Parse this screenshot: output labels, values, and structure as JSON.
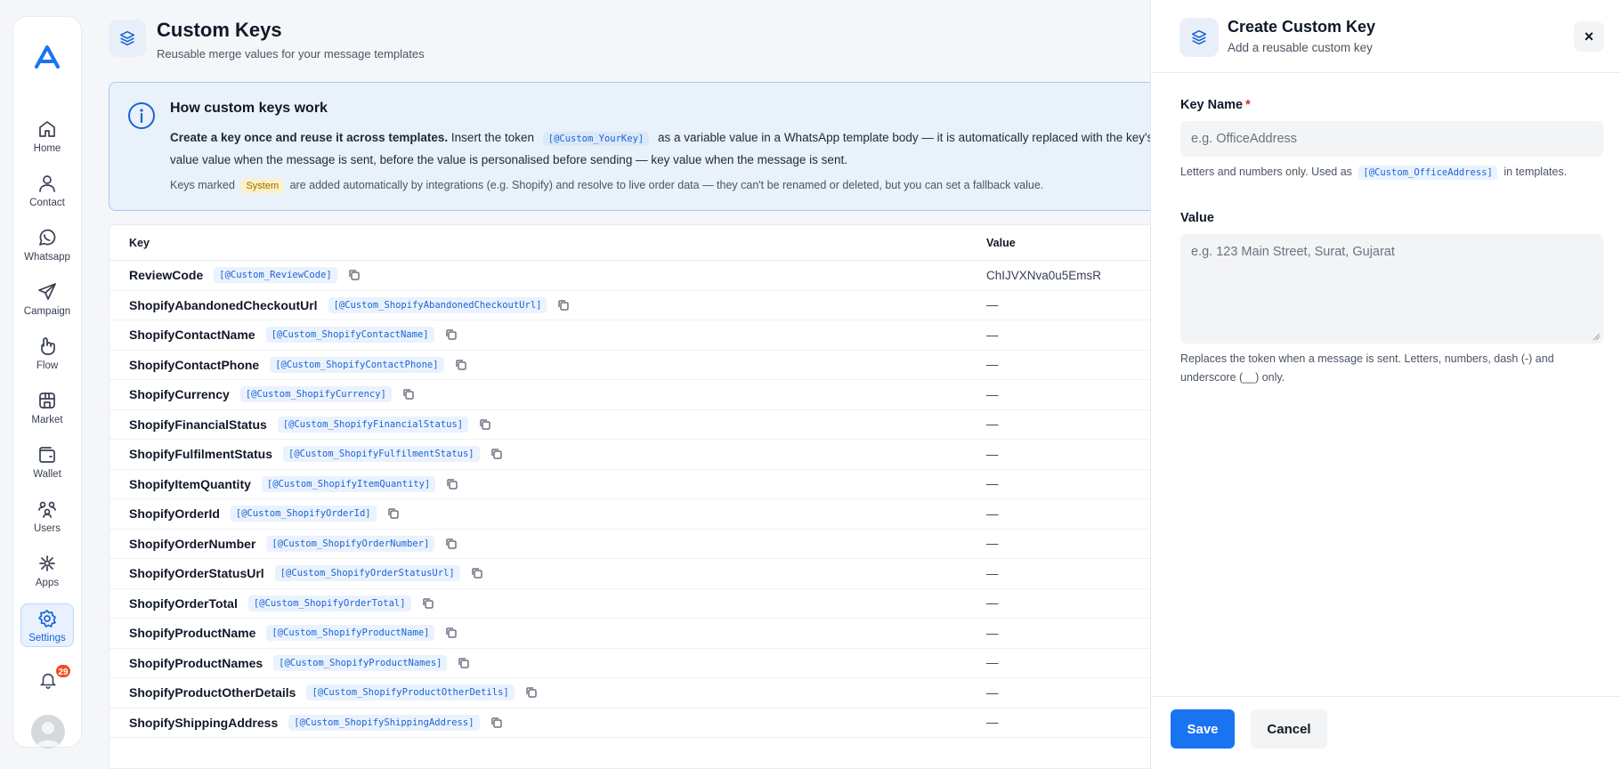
{
  "nav": {
    "items": [
      {
        "label": "Home",
        "icon": "home-icon"
      },
      {
        "label": "Contact",
        "icon": "contact-icon"
      },
      {
        "label": "Whatsapp",
        "icon": "whatsapp-icon"
      },
      {
        "label": "Campaign",
        "icon": "send-icon"
      },
      {
        "label": "Flow",
        "icon": "flow-icon"
      },
      {
        "label": "Market",
        "icon": "store-icon"
      },
      {
        "label": "Wallet",
        "icon": "wallet-icon"
      },
      {
        "label": "Users",
        "icon": "users-icon"
      },
      {
        "label": "Apps",
        "icon": "apps-icon"
      },
      {
        "label": "Settings",
        "icon": "gear-icon"
      }
    ],
    "active": "Settings",
    "notification_count": "29"
  },
  "header": {
    "title": "Custom Keys",
    "subtitle": "Reusable merge values for your message templates"
  },
  "info": {
    "title": "How custom keys work",
    "line1_bold": "Create a key once and reuse it across templates.",
    "line1_a": "Insert the token",
    "line1_token": "[@Custom_YourKey]",
    "line1_b": "as a variable value in a WhatsApp template body — it is automatically replaced with the key's",
    "line2": "value value when the message is sent, before the value is personalised before sending — key value when the message is sent.",
    "line3_a": "Keys marked",
    "line3_chip": "System",
    "line3_b": "are added automatically by integrations (e.g. Shopify) and resolve to live order data — they can't be renamed or deleted, but you can set a fallback value."
  },
  "table": {
    "col_key": "Key",
    "col_value": "Value",
    "rows": [
      {
        "key": "ReviewCode",
        "token": "[@Custom_ReviewCode]",
        "value": "ChIJVXNva0u5EmsR"
      },
      {
        "key": "ShopifyAbandonedCheckoutUrl",
        "token": "[@Custom_ShopifyAbandonedCheckoutUrl]",
        "value": "—"
      },
      {
        "key": "ShopifyContactName",
        "token": "[@Custom_ShopifyContactName]",
        "value": "—"
      },
      {
        "key": "ShopifyContactPhone",
        "token": "[@Custom_ShopifyContactPhone]",
        "value": "—"
      },
      {
        "key": "ShopifyCurrency",
        "token": "[@Custom_ShopifyCurrency]",
        "value": "—"
      },
      {
        "key": "ShopifyFinancialStatus",
        "token": "[@Custom_ShopifyFinancialStatus]",
        "value": "—"
      },
      {
        "key": "ShopifyFulfilmentStatus",
        "token": "[@Custom_ShopifyFulfilmentStatus]",
        "value": "—"
      },
      {
        "key": "ShopifyItemQuantity",
        "token": "[@Custom_ShopifyItemQuantity]",
        "value": "—"
      },
      {
        "key": "ShopifyOrderId",
        "token": "[@Custom_ShopifyOrderId]",
        "value": "—"
      },
      {
        "key": "ShopifyOrderNumber",
        "token": "[@Custom_ShopifyOrderNumber]",
        "value": "—"
      },
      {
        "key": "ShopifyOrderStatusUrl",
        "token": "[@Custom_ShopifyOrderStatusUrl]",
        "value": "—"
      },
      {
        "key": "ShopifyOrderTotal",
        "token": "[@Custom_ShopifyOrderTotal]",
        "value": "—"
      },
      {
        "key": "ShopifyProductName",
        "token": "[@Custom_ShopifyProductName]",
        "value": "—"
      },
      {
        "key": "ShopifyProductNames",
        "token": "[@Custom_ShopifyProductNames]",
        "value": "—"
      },
      {
        "key": "ShopifyProductOtherDetails",
        "token": "[@Custom_ShopifyProductOtherDetils]",
        "value": "—"
      },
      {
        "key": "ShopifyShippingAddress",
        "token": "[@Custom_ShopifyShippingAddress]",
        "value": "—"
      }
    ]
  },
  "drawer": {
    "title": "Create Custom Key",
    "subtitle": "Add a reusable custom key",
    "close_label": "×",
    "key_name_label": "Key Name",
    "required_mark": "*",
    "key_name_placeholder": "e.g. OfficeAddress",
    "key_name_value": "",
    "key_help_a": "Letters and numbers only. Used as",
    "key_help_token": "[@Custom_OfficeAddress]",
    "key_help_b": "in templates.",
    "value_label": "Value",
    "value_placeholder": "e.g. 123 Main Street, Surat, Gujarat",
    "value_value": "",
    "value_help": "Replaces the token when a message is sent. Letters, numbers, dash (-) and underscore (__) only.",
    "save_label": "Save",
    "cancel_label": "Cancel"
  },
  "colors": {
    "accent": "#1a73f0",
    "accent_dark": "#1a64d6",
    "badge": "#f04d23",
    "system_chip": "#fdf0c2"
  }
}
